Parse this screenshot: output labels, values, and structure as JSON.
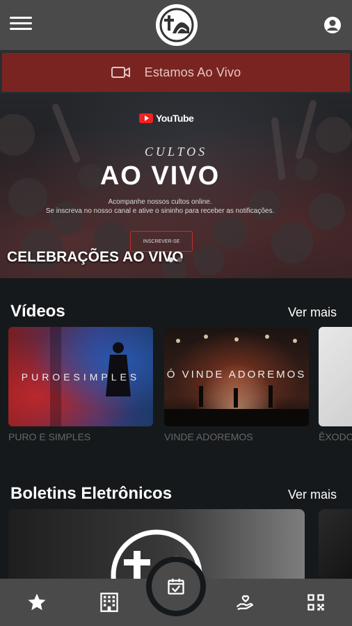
{
  "header": {
    "menu_icon": "hamburger-menu-icon",
    "logo_icon": "church-cross-logo",
    "account_icon": "account-circle-icon"
  },
  "live": {
    "label": "Estamos Ao Vivo",
    "icon": "video-camera-icon",
    "color": "#7a2421"
  },
  "hero": {
    "youtube_label": "YouTube",
    "cultos": "CULTOS",
    "title": "AO VIVO",
    "subtitle_line1": "Acompanhe nossos cultos online.",
    "subtitle_line2": "Se inscreva no nosso canal e ative o sininho para receber as notificações.",
    "cta": "INSCREVER-SE",
    "caption": "CELEBRAÇÕES AO VIVO"
  },
  "videos": {
    "title": "Vídeos",
    "see_more": "Ver mais",
    "items": [
      {
        "title": "PURO E SIMPLES",
        "thumb_text": "PUROESIMPLES"
      },
      {
        "title": "VINDE ADOREMOS",
        "thumb_text": "Ó VINDE ADOREMOS"
      },
      {
        "title": "ÊXODO",
        "thumb_text": ""
      }
    ]
  },
  "bulletins": {
    "title": "Boletins Eletrônicos",
    "see_more": "Ver mais"
  },
  "bottom_nav": {
    "items": [
      "star-icon",
      "building-icon",
      "calendar-check-icon",
      "heart-hand-icon",
      "qr-code-icon"
    ],
    "active": "calendar-check-icon"
  },
  "colors": {
    "topbar": "#4a4a4a",
    "background": "#16191b",
    "accent": "#7a2421"
  }
}
